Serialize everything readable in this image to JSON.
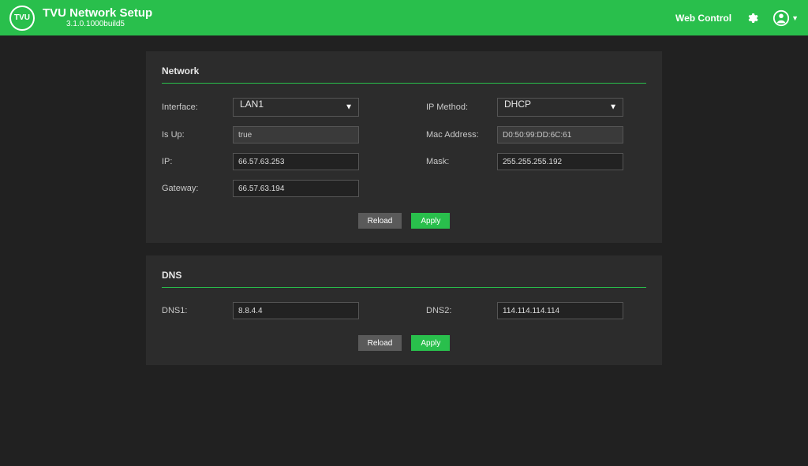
{
  "header": {
    "logo_text": "TVU",
    "title": "TVU Network Setup",
    "version": "3.1.0.1000build5",
    "web_control": "Web Control"
  },
  "network": {
    "section_title": "Network",
    "labels": {
      "interface": "Interface:",
      "ip_method": "IP Method:",
      "is_up": "Is Up:",
      "mac_address": "Mac Address:",
      "ip": "IP:",
      "mask": "Mask:",
      "gateway": "Gateway:"
    },
    "values": {
      "interface": "LAN1",
      "ip_method": "DHCP",
      "is_up": "true",
      "mac_address": "D0:50:99:DD:6C:61",
      "ip": "66.57.63.253",
      "mask": "255.255.255.192",
      "gateway": "66.57.63.194"
    },
    "buttons": {
      "reload": "Reload",
      "apply": "Apply"
    }
  },
  "dns": {
    "section_title": "DNS",
    "labels": {
      "dns1": "DNS1:",
      "dns2": "DNS2:"
    },
    "values": {
      "dns1": "8.8.4.4",
      "dns2": "114.114.114.114"
    },
    "buttons": {
      "reload": "Reload",
      "apply": "Apply"
    }
  },
  "colors": {
    "accent": "#29bf4c",
    "panel": "#2c2c2c",
    "bg": "#212121"
  }
}
